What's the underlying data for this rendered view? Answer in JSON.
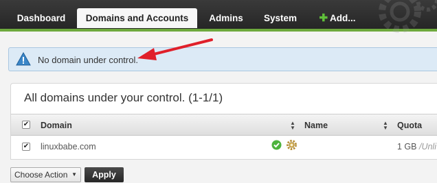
{
  "nav": {
    "tabs": [
      {
        "label": "Dashboard"
      },
      {
        "label": "Domains and Accounts"
      },
      {
        "label": "Admins"
      },
      {
        "label": "System"
      },
      {
        "label": "Add..."
      }
    ]
  },
  "notice": {
    "text": "No domain under control."
  },
  "panel": {
    "title": "All domains under your control. (1-1/1)",
    "columns": {
      "domain": "Domain",
      "name": "Name",
      "quota": "Quota"
    },
    "rows": [
      {
        "domain": "linuxbabe.com",
        "name": "",
        "quota": "1 GB",
        "quota_suffix": "/Unli"
      }
    ]
  },
  "actions": {
    "select": "Choose Action",
    "apply": "Apply"
  },
  "colors": {
    "accent": "#6ea93d",
    "notice_bg": "#dceaf6",
    "arrow": "#e0202a"
  }
}
